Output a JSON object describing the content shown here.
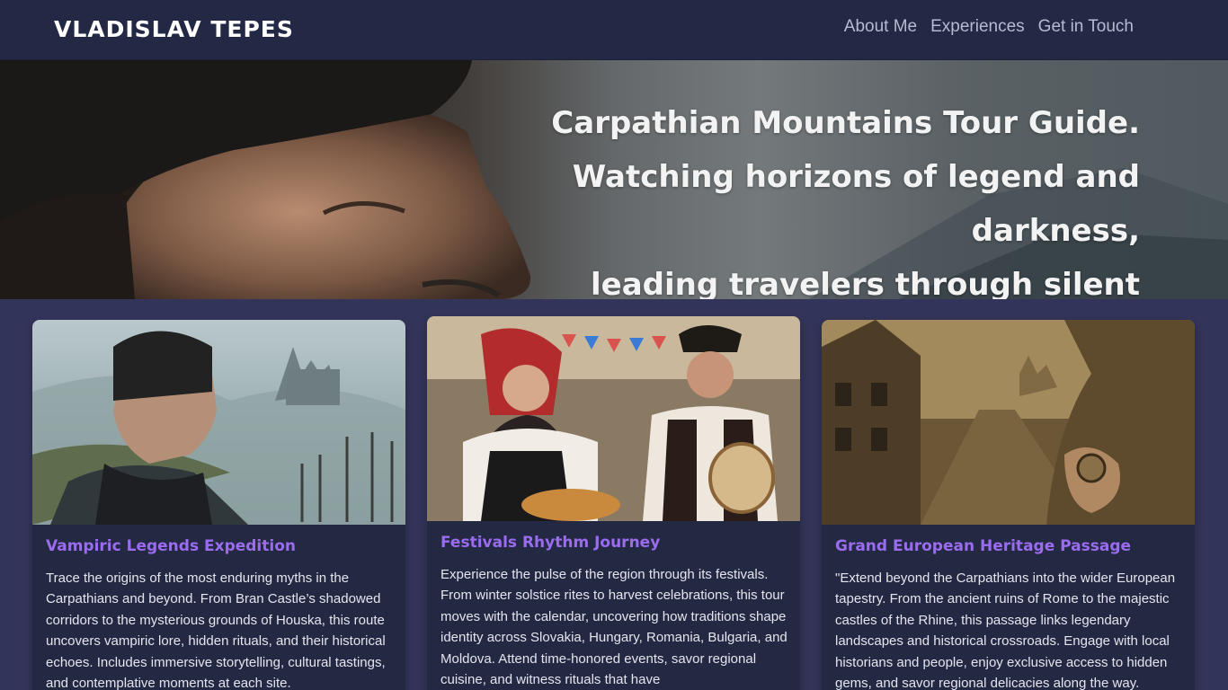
{
  "header": {
    "brand": "VLADISLAV TEPES",
    "nav": [
      "About Me",
      "Experiences",
      "Get in Touch"
    ]
  },
  "hero": {
    "lines": [
      "Carpathian Mountains Tour Guide.",
      "Watching horizons of legend and",
      "darkness,",
      "leading travelers through silent"
    ]
  },
  "cards": [
    {
      "title": "Vampiric Legends Expedition",
      "text": "Trace the origins of the most enduring myths in the Carpathians and beyond. From Bran Castle’s shadowed corridors to the mysterious grounds of Houska, this route uncovers vampiric lore, hidden rituals, and their historical echoes. Includes immersive storytelling, cultural tastings, and contemplative moments at each site."
    },
    {
      "title": "Festivals Rhythm Journey",
      "text": "Experience the pulse of the region through its festivals. From winter solstice rites to harvest celebrations, this tour moves with the calendar, uncovering how traditions shape identity across Slovakia, Hungary, Romania, Bulgaria, and Moldova. Attend time-honored events, savor regional cuisine, and witness rituals that have"
    },
    {
      "title": "Grand European Heritage Passage",
      "text": "\"Extend beyond the Carpathians into the wider European tapestry. From the ancient ruins of Rome to the majestic castles of the Rhine, this passage links legendary landscapes and historical crossroads. Engage with local historians and people, enjoy exclusive access to hidden gems, and savor regional delicacies along the way."
    }
  ],
  "colors": {
    "header_bg": "#232844",
    "page_bg": "#33345a",
    "card_bg": "#242943",
    "card_title": "#9b6cf0"
  }
}
